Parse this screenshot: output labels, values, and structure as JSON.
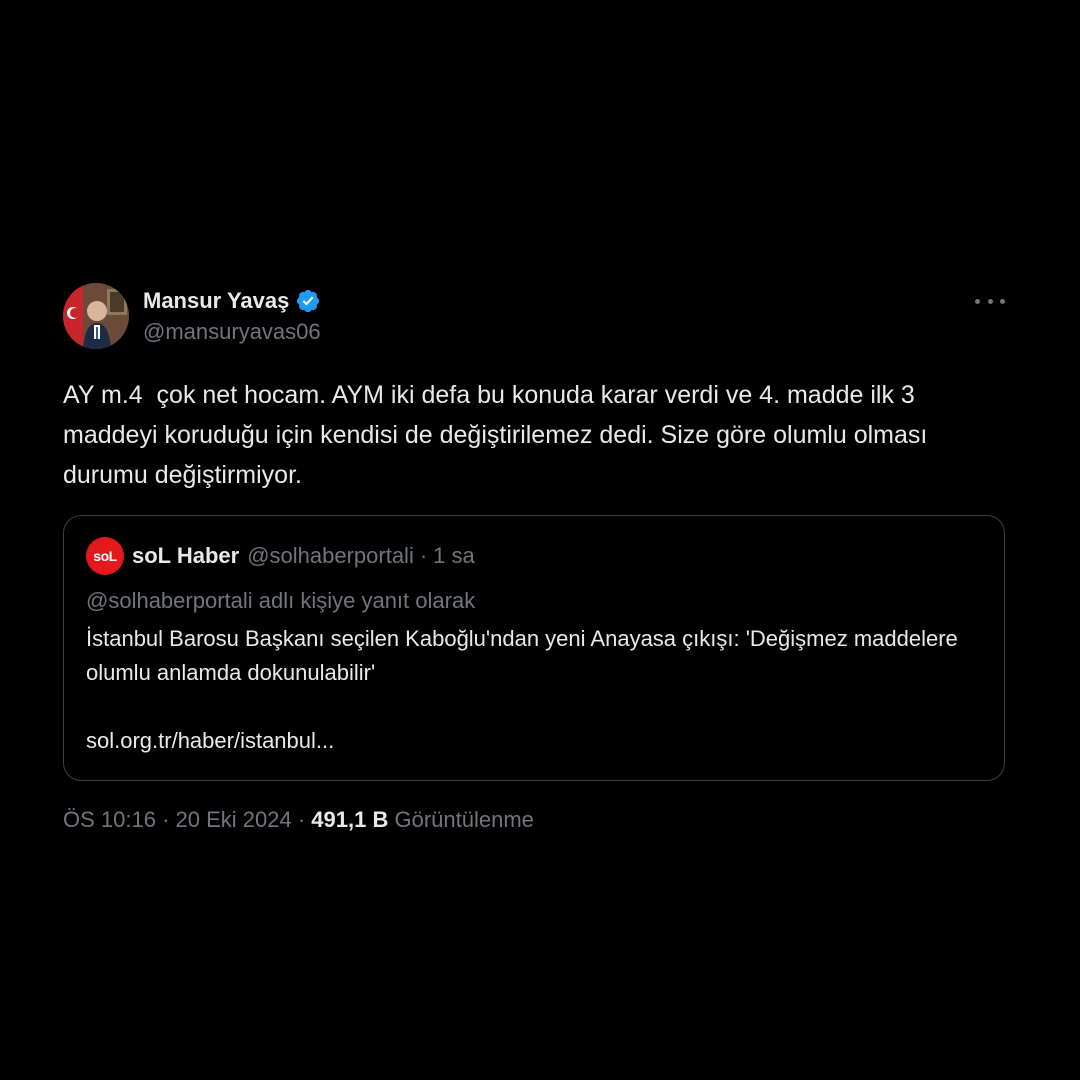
{
  "tweet": {
    "author": {
      "display_name": "Mansur Yavaş",
      "handle": "@mansuryavas06",
      "verified": true
    },
    "text": "AY m.4  çok net hocam. AYM iki defa bu konuda karar verdi ve 4. madde ilk 3 maddeyi koruduğu için kendisi de değiştirilemez dedi. Size göre olumlu olması durumu değiştirmiyor.",
    "quote": {
      "logo_text": "soL",
      "display_name": "soL Haber",
      "handle": "@solhaberportali",
      "separator": "·",
      "time": "1 sa",
      "reply_to": "@solhaberportali adlı kişiye yanıt olarak",
      "text": "İstanbul Barosu Başkanı seçilen Kaboğlu'ndan yeni Anayasa çıkışı: 'Değişmez maddelere olumlu anlamda dokunulabilir'",
      "link": "sol.org.tr/haber/istanbul..."
    },
    "meta": {
      "time": "ÖS 10:16",
      "separator": " · ",
      "date": "20 Eki 2024",
      "views_count": "491,1 B",
      "views_label": "Görüntülenme"
    }
  },
  "colors": {
    "background": "#000000",
    "text": "#e7e9ea",
    "muted": "#71767b",
    "border": "#3a3f44",
    "verified": "#1d9bf0",
    "sol_red": "#e3191c"
  }
}
